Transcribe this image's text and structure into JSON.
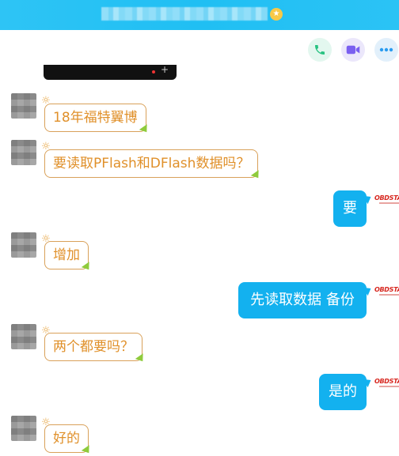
{
  "header": {
    "title_icon": "vip-star-badge"
  },
  "actions": [
    {
      "icon": "phone-icon",
      "color": "#27c281"
    },
    {
      "icon": "video-icon",
      "color": "#7a5ff0"
    },
    {
      "icon": "more-icon",
      "color": "#2a9bf0"
    }
  ],
  "colors": {
    "header": "#20bff3",
    "incoming_text": "#e0902a",
    "incoming_border": "#d9a15a",
    "outgoing_bubble": "#13b1ef"
  },
  "messages": [
    {
      "side": "in",
      "text": "18年福特翼博"
    },
    {
      "side": "in",
      "text": "要读取PFlash和DFlash数据吗？"
    },
    {
      "side": "out",
      "text": "要"
    },
    {
      "side": "in",
      "text": "增加"
    },
    {
      "side": "out",
      "text": "先读取数据 备份"
    },
    {
      "side": "in",
      "text": "两个都要吗？"
    },
    {
      "side": "out",
      "text": "是的"
    },
    {
      "side": "in",
      "text": "好的"
    }
  ],
  "brand_logo": "OBDSTAR"
}
